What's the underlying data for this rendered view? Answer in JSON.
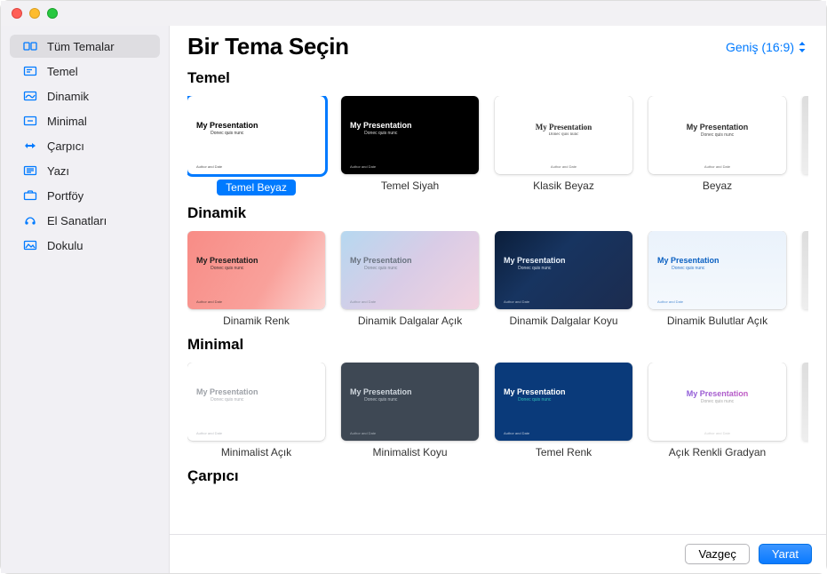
{
  "header": {
    "title": "Bir Tema Seçin",
    "aspect_label": "Geniş (16:9)"
  },
  "sidebar": {
    "items": [
      {
        "label": "Tüm Temalar",
        "selected": true,
        "iconName": "all-themes-icon"
      },
      {
        "label": "Temel",
        "selected": false,
        "iconName": "basic-icon"
      },
      {
        "label": "Dinamik",
        "selected": false,
        "iconName": "dynamic-icon"
      },
      {
        "label": "Minimal",
        "selected": false,
        "iconName": "minimal-icon"
      },
      {
        "label": "Çarpıcı",
        "selected": false,
        "iconName": "bold-icon"
      },
      {
        "label": "Yazı",
        "selected": false,
        "iconName": "editorial-icon"
      },
      {
        "label": "Portföy",
        "selected": false,
        "iconName": "portfolio-icon"
      },
      {
        "label": "El Sanatları",
        "selected": false,
        "iconName": "craft-icon"
      },
      {
        "label": "Dokulu",
        "selected": false,
        "iconName": "textured-icon"
      }
    ]
  },
  "main": {
    "sections": [
      {
        "title": "Temel",
        "themes": [
          {
            "label": "Temel Beyaz",
            "selected": true,
            "bg": "#ffffff",
            "text": "#000000",
            "align": "left",
            "title": "My Presentation",
            "sub": "Donec quis nunc",
            "author": "Author and Date"
          },
          {
            "label": "Temel Siyah",
            "selected": false,
            "bg": "#000000",
            "text": "#ffffff",
            "align": "left",
            "title": "My Presentation",
            "sub": "Donec quis nunc",
            "author": "Author and Date"
          },
          {
            "label": "Klasik Beyaz",
            "selected": false,
            "bg": "#ffffff",
            "text": "#2b2b2b",
            "align": "center",
            "title": "My Presentation",
            "sub": "Donec quis nunc",
            "author": "Author and Date",
            "serif": true
          },
          {
            "label": "Beyaz",
            "selected": false,
            "bg": "#ffffff",
            "text": "#2b2b2b",
            "align": "center",
            "title": "My Presentation",
            "sub": "Donec quis nunc",
            "author": "Author and Date"
          }
        ],
        "hasPeek": true
      },
      {
        "title": "Dinamik",
        "themes": [
          {
            "label": "Dinamik Renk",
            "selected": false,
            "bg": "linear-gradient(120deg,#f88c86 0%,#f9a19b 60%,#fcd7d4 100%)",
            "text": "#1c1c1c",
            "align": "left",
            "title": "My Presentation",
            "sub": "Donec quis nunc",
            "author": "Author and Date"
          },
          {
            "label": "Dinamik Dalgalar Açık",
            "selected": false,
            "bg": "linear-gradient(135deg,#b6d8f0 0%,#d9cce6 50%,#f2d3e0 100%)",
            "text": "#6a7380",
            "align": "left",
            "title": "My Presentation",
            "sub": "Donec quis nunc",
            "author": "Author and Date"
          },
          {
            "label": "Dinamik Dalgalar Koyu",
            "selected": false,
            "bg": "linear-gradient(135deg,#0b1e3a,#173460 40%,#1c2c4f 100%)",
            "text": "#eaf2fb",
            "align": "left",
            "title": "My Presentation",
            "sub": "Donec quis nunc",
            "author": "Author and Date"
          },
          {
            "label": "Dinamik Bulutlar Açık",
            "selected": false,
            "bg": "linear-gradient(180deg,#eaf2fb,#f5f9fd)",
            "text": "#0a60c2",
            "align": "left",
            "title": "My Presentation",
            "sub": "Donec quis nunc",
            "author": "Author and Date"
          }
        ],
        "hasPeek": true
      },
      {
        "title": "Minimal",
        "themes": [
          {
            "label": "Minimalist Açık",
            "selected": false,
            "bg": "#ffffff",
            "text": "#9ea2a8",
            "align": "left",
            "title": "My Presentation",
            "sub": "Donec quis nunc",
            "author": "Author and Date"
          },
          {
            "label": "Minimalist Koyu",
            "selected": false,
            "bg": "#3e4854",
            "text": "#cfd6dd",
            "align": "left",
            "title": "My Presentation",
            "sub": "Donec quis nunc",
            "author": "Author and Date"
          },
          {
            "label": "Temel Renk",
            "selected": false,
            "bg": "#0a3a7a",
            "text": "#ffffff",
            "subColor": "#38d3c3",
            "align": "left",
            "title": "My Presentation",
            "sub": "Donec quis nunc",
            "author": "Author and Date"
          },
          {
            "label": "Açık Renkli Gradyan",
            "selected": false,
            "bg": "#ffffff",
            "text": "linear-gradient(90deg,#6c5ce7,#e056b3)",
            "gradientText": true,
            "subColor": "#9b9b9b",
            "align": "center",
            "title": "My Presentation",
            "sub": "Donec quis nunc",
            "author": "Author and Date"
          }
        ],
        "hasPeek": true
      },
      {
        "title": "Çarpıcı",
        "themes": [],
        "hasPeek": false
      }
    ]
  },
  "footer": {
    "cancel": "Vazgeç",
    "create": "Yarat"
  }
}
